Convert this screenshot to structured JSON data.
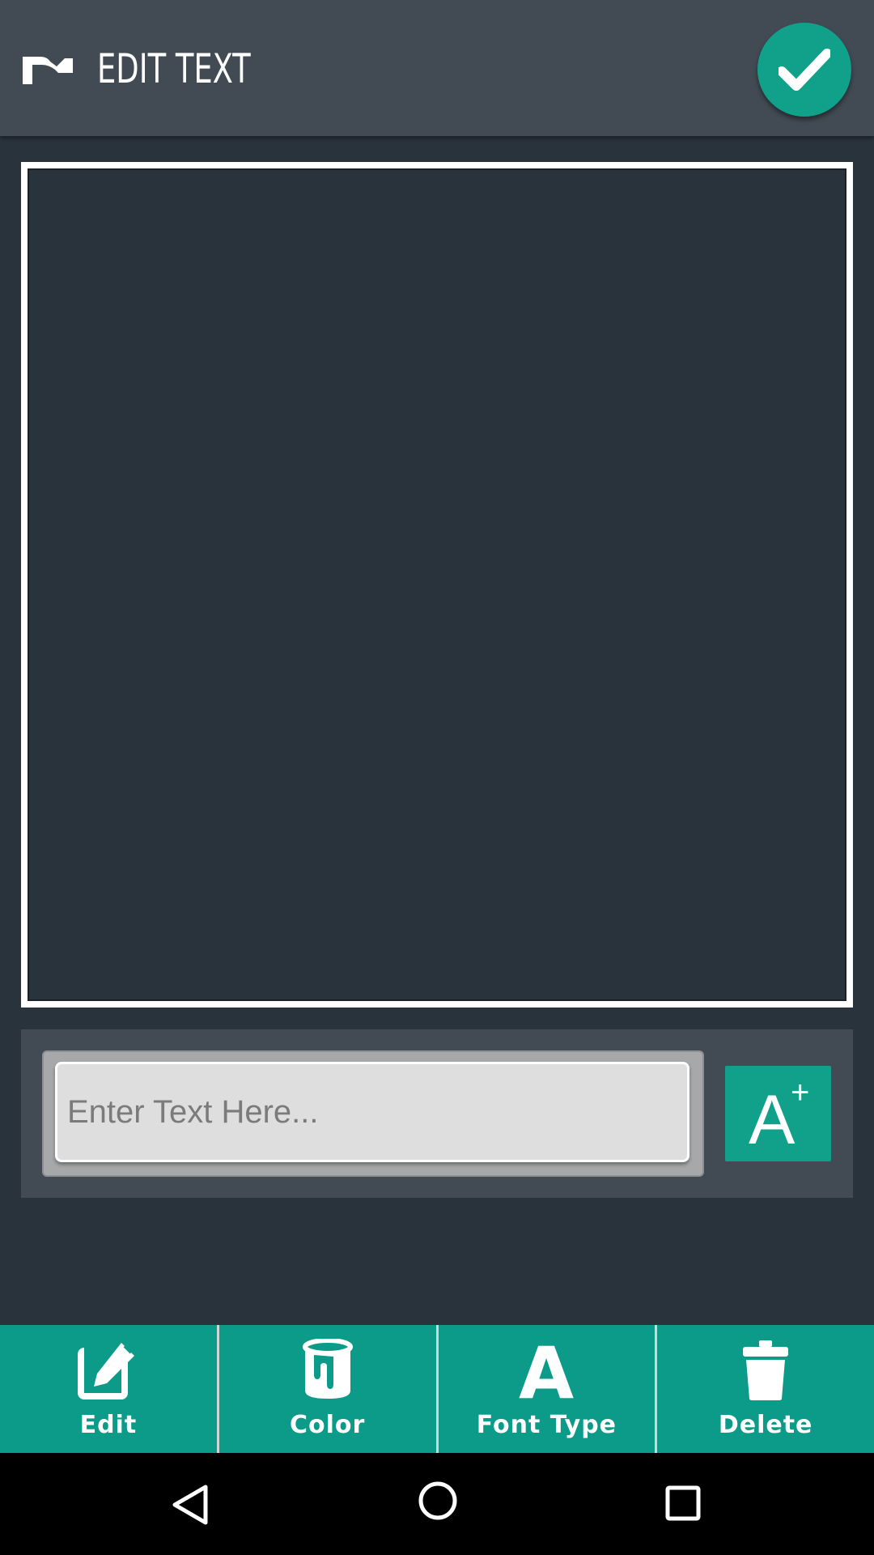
{
  "header": {
    "title": "EDIT TEXT",
    "back_icon": "curved-arrow-icon",
    "confirm_icon": "checkmark-icon"
  },
  "input": {
    "placeholder": "Enter Text Here...",
    "value": ""
  },
  "font_size_button": {
    "icon": "text-increase-icon",
    "glyph": "A",
    "superscript": "+"
  },
  "toolbar": {
    "items": [
      {
        "label": "Edit",
        "icon": "edit-pencil-icon"
      },
      {
        "label": "Color",
        "icon": "paint-bucket-icon"
      },
      {
        "label": "Font Type",
        "icon": "font-letter-icon",
        "glyph": "A"
      },
      {
        "label": "Delete",
        "icon": "trash-icon"
      }
    ]
  },
  "colors": {
    "background": "#29333b",
    "header": "#424b54",
    "accent": "#11a08a",
    "toolbar": "#0b9b88"
  }
}
